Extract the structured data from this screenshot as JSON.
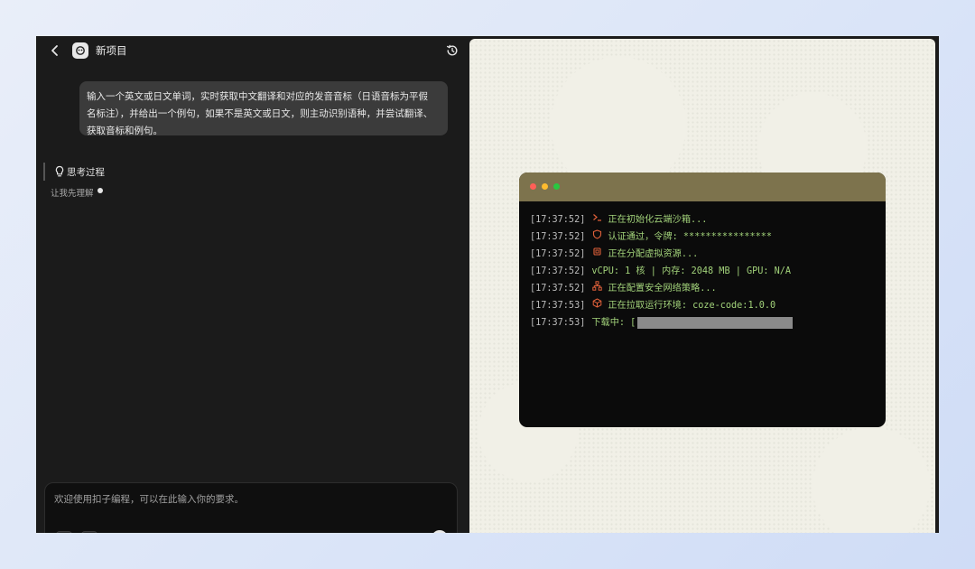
{
  "header": {
    "project_title": "新项目"
  },
  "conversation": {
    "user_prompt_lines": [
      "输入一个英文或日文单词，实时获取中文翻译和对应的发音音标（日语音标为平假",
      "名标注），并给出一个例句，如果不是英文或日文，则主动识别语种，并尝试翻译、",
      "获取音标和例句。"
    ],
    "thinking": {
      "label": "思考过程",
      "status": "让我先理解"
    }
  },
  "composer": {
    "placeholder": "欢迎使用扣子编程，可以在此输入你的要求。"
  },
  "terminal": {
    "window_dots": [
      "#ff5f57",
      "#febc2e",
      "#28c840"
    ],
    "lines": [
      {
        "time": "[17:37:52]",
        "icon": "prompt-icon",
        "icon_color": "#e0603a",
        "text": "正在初始化云端沙箱..."
      },
      {
        "time": "[17:37:52]",
        "icon": "shield-icon",
        "icon_color": "#e0603a",
        "text": "认证通过，令牌: ****************"
      },
      {
        "time": "[17:37:52]",
        "icon": "chip-icon",
        "icon_color": "#e0603a",
        "text": "正在分配虚拟资源..."
      },
      {
        "time": "[17:37:52]",
        "icon": "",
        "icon_color": "",
        "text": "vCPU: 1 核 | 内存: 2048 MB | GPU: N/A"
      },
      {
        "time": "[17:37:52]",
        "icon": "network-icon",
        "icon_color": "#e0603a",
        "text": "正在配置安全网络策略..."
      },
      {
        "time": "[17:37:53]",
        "icon": "package-icon",
        "icon_color": "#e0603a",
        "text": "正在拉取运行环境: coze-code:1.0.0"
      },
      {
        "time": "[17:37:53]",
        "icon": "",
        "icon_color": "",
        "text": "下载中: ["
      }
    ],
    "download_progress": 0.0,
    "text_color": "#a2d27a",
    "title_bar_color": "#7d734d"
  }
}
